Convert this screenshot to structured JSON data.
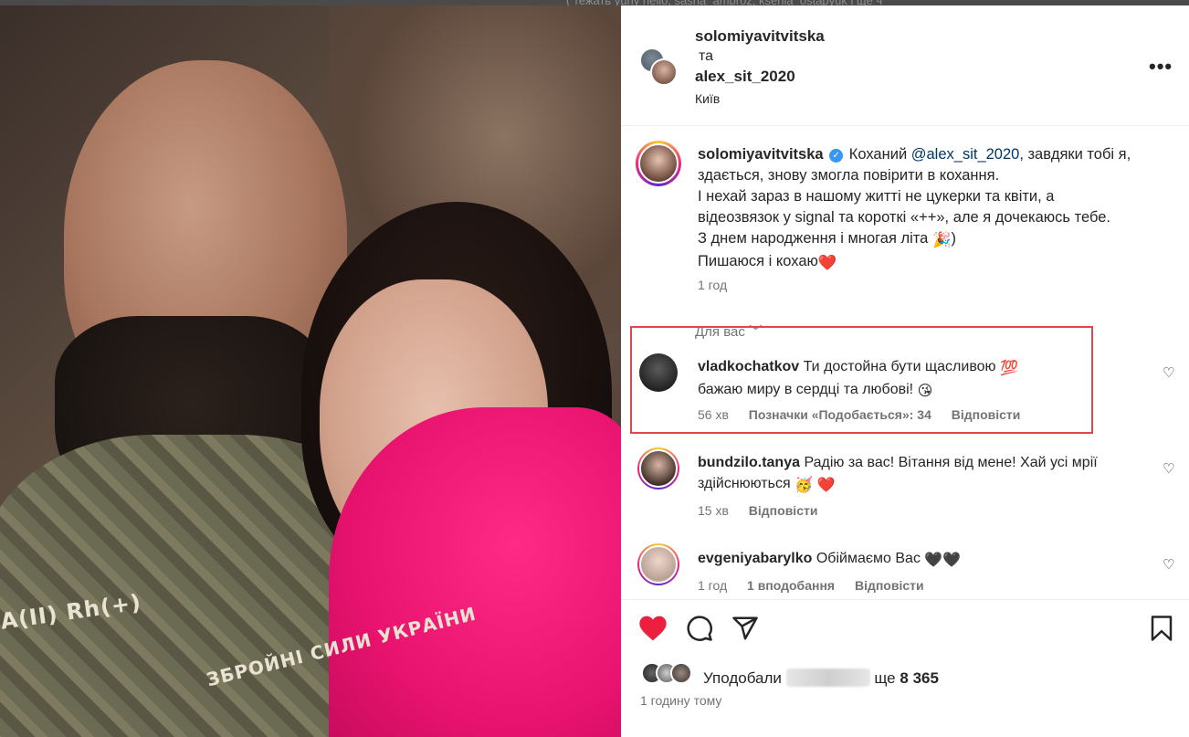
{
  "top_strip_text": "( тежать yuriy hello, sasha_ambroz, ksenia_ostapyuk і ще ч",
  "photo": {
    "badge_text_1": "A(II) Rh(+)",
    "badge_text_2": "ЗБРОЙНІ СИЛИ УКРАЇНИ"
  },
  "header": {
    "user1": "solomiyavitvitska",
    "and": "та",
    "user2": "alex_sit_2020",
    "location": "Київ",
    "more_icon": "more-horizontal-icon"
  },
  "caption": {
    "username": "solomiyavitvitska",
    "verified_icon": "verified-badge-icon",
    "prefix": "Коханий ",
    "mention": "@alex_sit_2020",
    "line1_rest": ", завдяки тобі я,",
    "line2": "здається, знову змогла повірити в кохання.",
    "line3": "І нехай зараз в нашому житті не цукерки та квіти, а",
    "line4": "відеозвязок у signal та короткі «++», але я дочекаюсь тебе.",
    "line5": "З днем народження і многая літа",
    "line5_emoji": "🎉",
    "line5_end": ")",
    "line6": "Пишаюся і кохаю",
    "line6_emoji": "❤️",
    "time": "1 год"
  },
  "for_you_label": "Для вас",
  "comments": [
    {
      "username": "vladkochatkov",
      "text_line1": "Ти достойна бути щасливою",
      "emoji1": "💯",
      "text_line2": "бажаю миру в сердці та любові!",
      "emoji2": "😘",
      "time": "56 хв",
      "likes": "Позначки «Подобається»: 34",
      "reply": "Відповісти"
    },
    {
      "username": "bundzilo.tanya",
      "text_line1": "Радію за вас! Вітання від мене! Хай усі мрії",
      "text_line2": "здійснюються",
      "emoji1": "🥳",
      "emoji2": "❤️",
      "time": "15 хв",
      "reply": "Відповісти"
    },
    {
      "username": "evgeniyabarylko",
      "text_line1": "Обіймаємо Вас",
      "emoji1": "🖤🖤",
      "time": "1 год",
      "likes": "1 вподобання",
      "reply": "Відповісти"
    }
  ],
  "actions": {
    "like_icon": "heart-filled-icon",
    "comment_icon": "comment-icon",
    "share_icon": "share-icon",
    "save_icon": "bookmark-icon"
  },
  "likes": {
    "prefix": "Уподобали",
    "suffix": "ще",
    "count": "8 365"
  },
  "post_time": "1 годину тому",
  "colors": {
    "like_red": "#ed1f3e",
    "highlight_border": "#e0464c",
    "link": "#00376b",
    "verified": "#3897f0"
  }
}
